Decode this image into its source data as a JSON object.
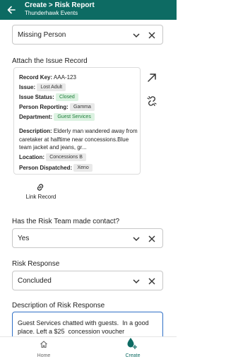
{
  "header": {
    "title": "Create > Risk Report",
    "subtitle": "Thunderhawk Events"
  },
  "top_select": {
    "value": "Missing Person"
  },
  "issue_record": {
    "section_label": "Attach the Issue Record",
    "record_key_label": "Record Key:",
    "record_key": "AAA-123",
    "issue_label": "Issue:",
    "issue": "Lost Adult",
    "status_label": "Issue Status:",
    "status": "Closed",
    "reporting_label": "Person Reporting:",
    "reporting": "Gamma",
    "department_label": "Department:",
    "department": "Guest Services",
    "description_label": "Description:",
    "description": "Elderly man wandered away from caretaker at halftime near concessions.Blue team jacket and jeans, gr...",
    "location_label": "Location:",
    "location": "Concessions B",
    "dispatched_label": "Person Dispatched:",
    "dispatched": "Xeno",
    "link_label": "Link Record"
  },
  "contact": {
    "label": "Has the Risk Team made contact?",
    "value": "Yes"
  },
  "risk_response": {
    "label": "Risk Response",
    "value": "Concluded"
  },
  "description_response": {
    "label": "Description of Risk Response",
    "value": "Guest Services chatted with guests.  In a good place. Left a $25  concession voucher"
  },
  "nav": {
    "home": "Home",
    "create": "Create"
  },
  "colors": {
    "header": "#0d6b63",
    "focus": "#2f6fc6",
    "chip_green": "#dcf2e1"
  }
}
